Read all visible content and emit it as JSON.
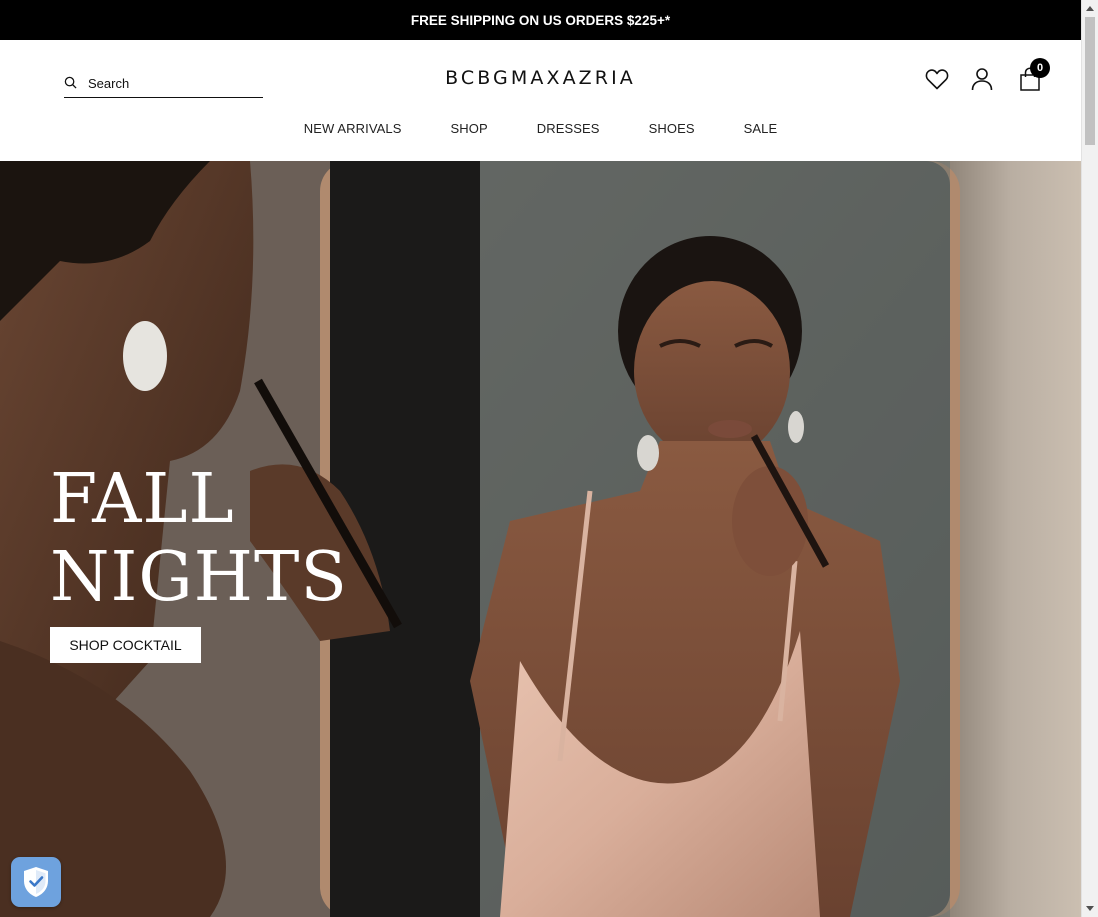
{
  "announcement": {
    "text": "FREE SHIPPING ON US ORDERS $225+*"
  },
  "header": {
    "search_placeholder": "Search",
    "logo": "BCBGMAXAZRIA",
    "icons": {
      "wishlist": "heart-icon",
      "account": "user-icon",
      "cart": "shopping-bag-icon"
    },
    "cart_count": "0"
  },
  "nav": {
    "items": [
      {
        "label": "NEW ARRIVALS"
      },
      {
        "label": "SHOP"
      },
      {
        "label": "DRESSES"
      },
      {
        "label": "SHOES"
      },
      {
        "label": "SALE"
      }
    ]
  },
  "hero": {
    "title_line1": "FALL",
    "title_line2": "NIGHTS",
    "cta_label": "SHOP COCKTAIL"
  },
  "trust_badge": {
    "icon": "shield-check-icon",
    "color": "#6ea2de"
  },
  "colors": {
    "announcement_bg": "#000000",
    "text": "#111111"
  }
}
